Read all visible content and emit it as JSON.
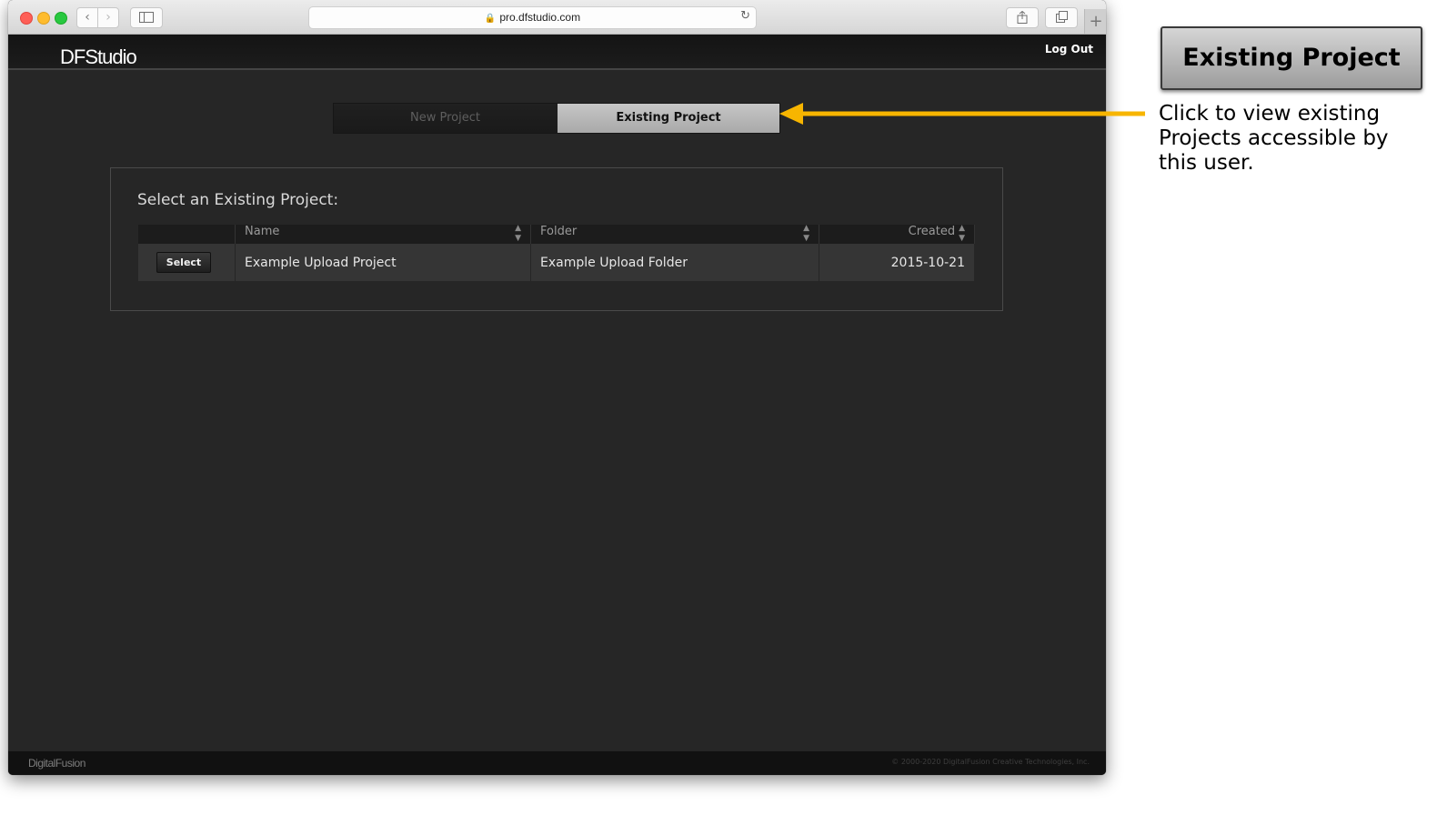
{
  "browser": {
    "url": "pro.dfstudio.com",
    "icons": [
      "back-icon",
      "forward-icon",
      "sidebar-icon",
      "lock-icon",
      "reload-icon",
      "share-icon",
      "tabs-icon",
      "plus-icon"
    ]
  },
  "app": {
    "logo": "DFStudio",
    "logout_label": "Log Out"
  },
  "tabs": {
    "new_project": "New Project",
    "existing_project": "Existing Project",
    "active": "existing_project"
  },
  "panel": {
    "title": "Select an Existing Project:",
    "columns": {
      "name": "Name",
      "folder": "Folder",
      "created": "Created"
    },
    "rows": [
      {
        "action": "Select",
        "name": "Example Upload Project",
        "folder": "Example Upload Folder",
        "created": "2015-10-21"
      }
    ]
  },
  "footer": {
    "logo": "DigitalFusion",
    "copyright": "© 2000-2020 DigitalFusion Creative Technologies, Inc."
  },
  "annotation": {
    "button_label": "Existing Project",
    "description": "Click to view existing Projects accessible by this user.",
    "arrow_color": "#f7b500"
  }
}
